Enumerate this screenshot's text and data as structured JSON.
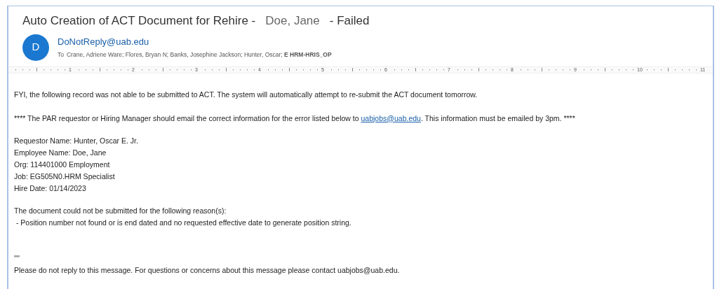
{
  "subject": [
    "Auto Creation of ACT Document for Rehire -",
    "Doe, Jane",
    "- Failed"
  ],
  "sender": {
    "avatar": "D",
    "address": "DoNotReply@uab.edu",
    "to_label": "To",
    "recipients": "Crane, Adriene Ware; Flores, Bryan N; Banks, Josephine Jackson; Hunter, Oscar; **E HRM-HRIS_OP**"
  },
  "ruler_numbers": [
    "1",
    "2",
    "3",
    "4",
    "5",
    "6",
    "7",
    "8",
    "9",
    "10",
    "11"
  ],
  "body": {
    "intro": "FYI, the following record was not able to be submitted to ACT. The system will automatically attempt to re-submit the ACT document tomorrow.",
    "notice": {
      "before": "**** The PAR requestor or Hiring Manager should email the correct information for the error listed below to",
      "link": "uabjobs@uab.edu",
      "after": ".  This information must be emailed by 3pm. ****"
    },
    "details": [
      "Requestor Name: Hunter, Oscar E. Jr.",
      "Employee Name: Doe, Jane",
      "Org: 114401000 Employment",
      "Job: EG505N0.HRM Specialist",
      "Hire Date: 01/14/2023"
    ],
    "reason_heading": "The document could not be submitted for the following reason(s):",
    "reasons": [
      " - Position number not found or is end dated and no requested effective date to generate position string."
    ],
    "marks": "''''",
    "footer": "Please do not reply to this message.  For questions or concerns about this message please contact uabjobs@uab.edu."
  }
}
